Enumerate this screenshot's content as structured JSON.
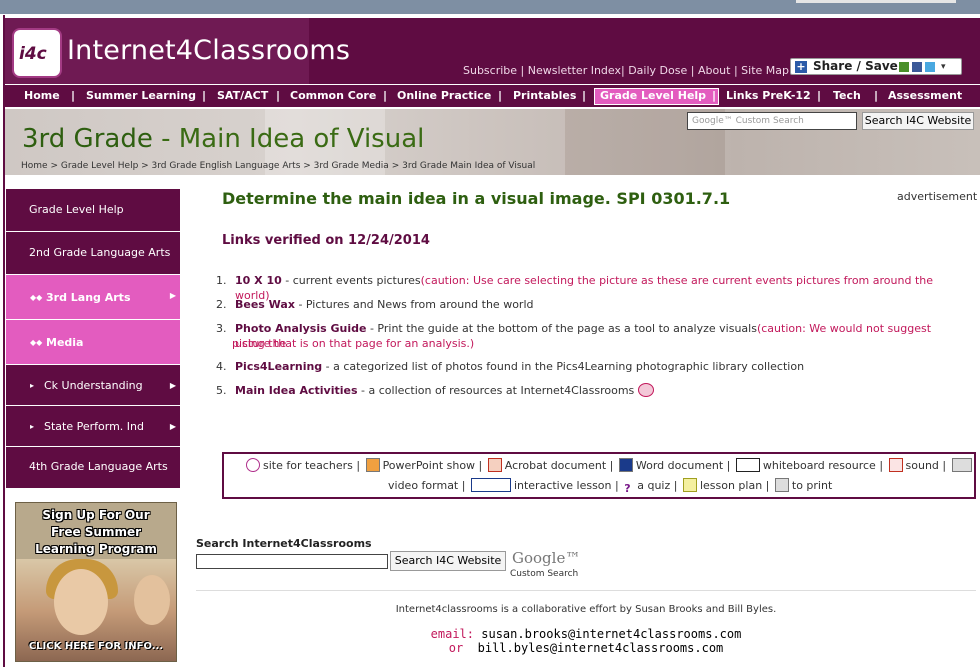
{
  "site": {
    "logo_mark": "i4c",
    "logo_text": "Internet4Classrooms",
    "toplinks": [
      "Subscribe",
      "Newsletter Index",
      "Daily Dose",
      "About",
      "Site Map"
    ],
    "share_label": "Share / Save"
  },
  "nav": [
    "Home",
    "Summer Learning",
    "SAT/ACT",
    "Common Core",
    "Online Practice",
    "Printables",
    "Grade Level Help",
    "Links PreK-12",
    "Tech",
    "Assessment"
  ],
  "banner": {
    "title_grade": "3rd Grade",
    "title_rest": " - Main Idea of Visual",
    "breadcrumb": "Home > Grade Level Help > 3rd Grade English Language Arts > 3rd Grade Media > 3rd Grade Main Idea of Visual",
    "search_placeholder": "Google™ Custom Search",
    "search_button": "Search I4C Website"
  },
  "sidebar": [
    "Grade Level Help",
    "2nd Grade Language Arts",
    "3rd Lang Arts",
    "Media",
    "Ck Understanding",
    "State Perform. Ind",
    "4th Grade Language Arts"
  ],
  "promo": {
    "line1": "Sign Up For Our",
    "line2": "Free Summer",
    "line3": "Learning Program",
    "click": "CLICK HERE FOR INFO..."
  },
  "main": {
    "heading": "Determine the main idea in a visual image. SPI 0301.7.1",
    "advertisement": "advertisement",
    "verified": "Links verified on 12/24/2014",
    "items": [
      {
        "num": "1.",
        "link": "10 X 10",
        "desc": " - current events pictures",
        "caution": "(caution: Use care selecting the picture as these are current events pictures from around the world)",
        "caution2": ""
      },
      {
        "num": "2.",
        "link": "Bees Wax",
        "desc": " - Pictures and News from around the world",
        "caution": "",
        "caution2": ""
      },
      {
        "num": "3.",
        "link": "Photo Analysis Guide",
        "desc": " - Print the guide at the bottom of the page as a tool to analyze visuals",
        "caution": "(caution: We would not suggest using the",
        "caution2": "picture that is on that page for an analysis.)"
      },
      {
        "num": "4.",
        "link": "Pics4Learning",
        "desc": " - a categorized list of photos found in the Pics4Learning photographic library collection",
        "caution": "",
        "caution2": ""
      },
      {
        "num": "5.",
        "link": "Main Idea Activities",
        "desc": " - a collection of resources at Internet4Classrooms",
        "caution": "",
        "caution2": ""
      }
    ]
  },
  "legend": {
    "row1": [
      "site for teachers |",
      "PowerPoint show |",
      "Acrobat document |",
      "Word document |",
      "whiteboard resource |",
      "sound |"
    ],
    "row2": [
      "video format |",
      "interactive lesson |",
      "a quiz |",
      "lesson plan |",
      "to print"
    ]
  },
  "footer": {
    "search_label": "Search Internet4Classrooms",
    "search_button": "Search I4C Website",
    "google": "Google™",
    "custom_search": "Custom Search",
    "collab": "Internet4classrooms is a collaborative effort by Susan Brooks and Bill Byles.",
    "email_label": "email:",
    "email1": "susan.brooks@internet4classrooms.com",
    "or_label": "or",
    "email2": "bill.byles@internet4classrooms.com"
  }
}
